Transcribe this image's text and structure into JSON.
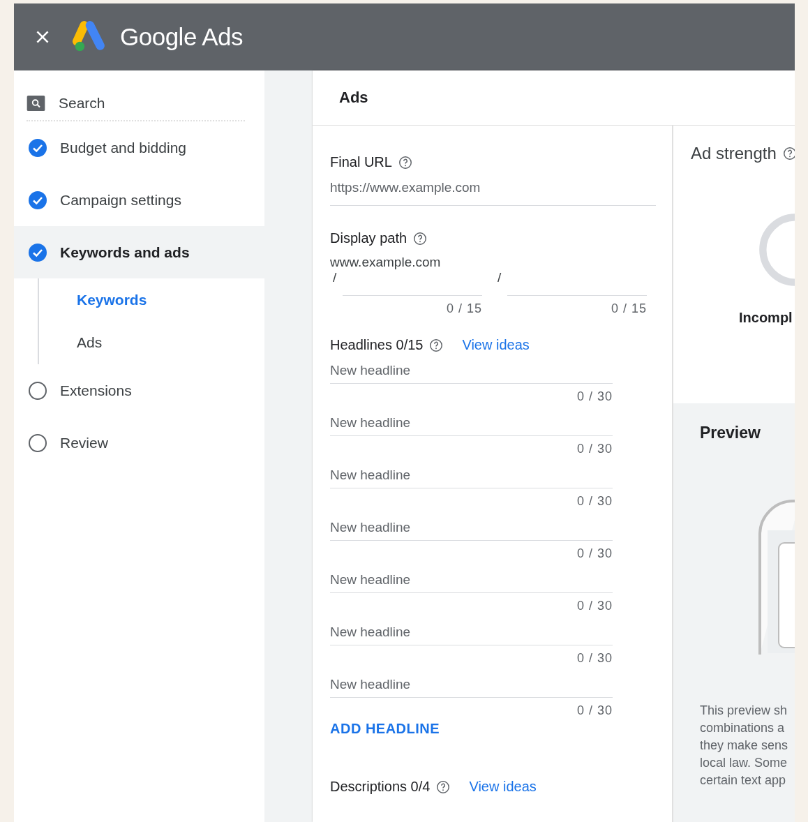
{
  "header": {
    "title": "Google Ads"
  },
  "sidebar": {
    "items": [
      {
        "kind": "search",
        "label": "Search"
      },
      {
        "kind": "step",
        "label": "Budget and bidding",
        "complete": true,
        "selected": false
      },
      {
        "kind": "step",
        "label": "Campaign settings",
        "complete": true,
        "selected": false
      },
      {
        "kind": "step",
        "label": "Keywords and ads",
        "complete": true,
        "selected": true,
        "children": [
          {
            "label": "Keywords",
            "selected": true
          },
          {
            "label": "Ads",
            "selected": false
          }
        ]
      },
      {
        "kind": "step",
        "label": "Extensions",
        "complete": false,
        "selected": false
      },
      {
        "kind": "step",
        "label": "Review",
        "complete": false,
        "selected": false
      }
    ]
  },
  "card": {
    "title": "Ads"
  },
  "form": {
    "final_url": {
      "label": "Final URL",
      "placeholder": "https://www.example.com"
    },
    "display_path": {
      "label": "Display path",
      "domain": "www.example.com",
      "paths": [
        {
          "separator": "/",
          "counter": "0 / 15"
        },
        {
          "separator": "/",
          "counter": "0 / 15"
        }
      ]
    },
    "headlines": {
      "label": "Headlines 0/15",
      "link": "View ideas",
      "fields": [
        {
          "placeholder": "New headline",
          "counter": "0 / 30"
        },
        {
          "placeholder": "New headline",
          "counter": "0 / 30"
        },
        {
          "placeholder": "New headline",
          "counter": "0 / 30"
        },
        {
          "placeholder": "New headline",
          "counter": "0 / 30"
        },
        {
          "placeholder": "New headline",
          "counter": "0 / 30"
        },
        {
          "placeholder": "New headline",
          "counter": "0 / 30"
        },
        {
          "placeholder": "New headline",
          "counter": "0 / 30"
        }
      ],
      "add_button": "ADD HEADLINE"
    },
    "descriptions": {
      "label": "Descriptions 0/4",
      "link": "View ideas"
    }
  },
  "ad_strength": {
    "title": "Ad strength",
    "rating": "Incompl"
  },
  "preview": {
    "title": "Preview",
    "note_lines": [
      "This preview sh",
      "combinations a",
      "they make sens",
      "local law. Some",
      "certain text app"
    ]
  }
}
